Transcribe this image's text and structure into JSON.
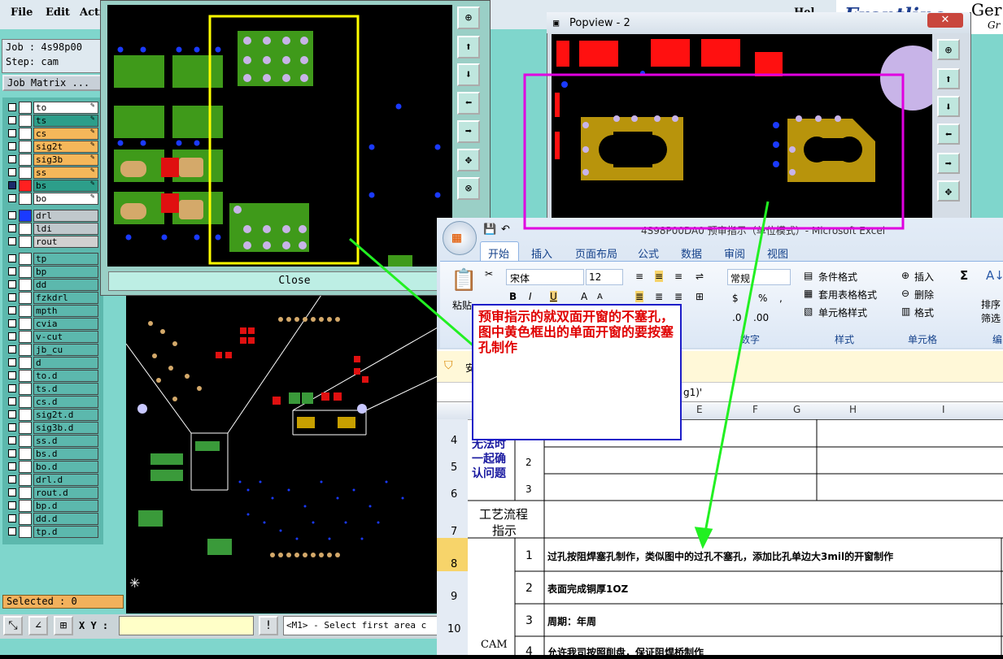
{
  "menu": {
    "file": "File",
    "edit": "Edit",
    "action": "Acti",
    "help": "Hel"
  },
  "logo": {
    "brand": "Frontline",
    "brand2": "Ger",
    "brand3": "Gr"
  },
  "job": {
    "line1": "Job : 4s98p00",
    "line2": "Step: cam",
    "matrix_button": "Job Matrix ..."
  },
  "layers": [
    {
      "name": "to",
      "color": "#ffffff"
    },
    {
      "name": "ts",
      "color": "#2d9e8a"
    },
    {
      "name": "cs",
      "color": "#f5b75a"
    },
    {
      "name": "sig2t",
      "color": "#f5b75a"
    },
    {
      "name": "sig3b",
      "color": "#f5b75a"
    },
    {
      "name": "ss",
      "color": "#f5b75a"
    },
    {
      "name": "bs",
      "color": "#2d9e8a"
    },
    {
      "name": "bo",
      "color": "#ffffff"
    },
    {
      "name": "drl",
      "color": "#c0c8cc"
    },
    {
      "name": "ldi",
      "color": "#c0c8cc"
    },
    {
      "name": "rout",
      "color": "#d0d0d0"
    },
    {
      "name": "tp",
      "color": "#5cb8ad"
    },
    {
      "name": "bp",
      "color": "#5cb8ad"
    },
    {
      "name": "dd",
      "color": "#5cb8ad"
    },
    {
      "name": "fzkdrl",
      "color": "#5cb8ad"
    },
    {
      "name": "mpth",
      "color": "#5cb8ad"
    },
    {
      "name": "cvia",
      "color": "#5cb8ad"
    },
    {
      "name": "v-cut",
      "color": "#5cb8ad"
    },
    {
      "name": "jb_cu",
      "color": "#5cb8ad"
    },
    {
      "name": "d",
      "color": "#5cb8ad"
    },
    {
      "name": "to.d",
      "color": "#5cb8ad"
    },
    {
      "name": "ts.d",
      "color": "#5cb8ad"
    },
    {
      "name": "cs.d",
      "color": "#5cb8ad"
    },
    {
      "name": "sig2t.d",
      "color": "#5cb8ad"
    },
    {
      "name": "sig3b.d",
      "color": "#5cb8ad"
    },
    {
      "name": "ss.d",
      "color": "#5cb8ad"
    },
    {
      "name": "bs.d",
      "color": "#5cb8ad"
    },
    {
      "name": "bo.d",
      "color": "#5cb8ad"
    },
    {
      "name": "drl.d",
      "color": "#5cb8ad"
    },
    {
      "name": "rout.d",
      "color": "#5cb8ad"
    },
    {
      "name": "bp.d",
      "color": "#5cb8ad"
    },
    {
      "name": "dd.d",
      "color": "#5cb8ad"
    },
    {
      "name": "tp.d",
      "color": "#5cb8ad"
    }
  ],
  "status": {
    "selected": "Selected : 0",
    "xy_label": "X Y :",
    "prompt": "<M1> - Select first area c"
  },
  "popview1": {
    "close": "Close"
  },
  "popview2": {
    "title": "Popview - 2",
    "close": "✕"
  },
  "excel": {
    "tabs": [
      "开始",
      "插入",
      "页面布局",
      "公式",
      "数据",
      "审阅",
      "视图"
    ],
    "font": "宋体",
    "size": "12",
    "numfmt": "常规",
    "paste": "粘贴",
    "styles": [
      "条件格式",
      "套用表格格式",
      "单元格样式"
    ],
    "cells_group": [
      "插入",
      "删除",
      "格式"
    ],
    "groups": [
      "数字",
      "样式",
      "单元格",
      "编"
    ],
    "sort": "排序",
    "filter": "筛选",
    "security": "安",
    "formula_tail": "g1)'",
    "title_frag": "4S98P00DA0 预审指示（单位模式）- Microsoft Excel",
    "cols": [
      "E",
      "F",
      "G",
      "H",
      "I"
    ],
    "rows": [
      {
        "num": "4",
        "a": "无法时",
        "b": "",
        "c": ""
      },
      {
        "num": "5",
        "a": "一起确",
        "b": "2",
        "c": ""
      },
      {
        "num": "6",
        "a": "认问题",
        "b": "3",
        "c": ""
      },
      {
        "num": "7",
        "a": "工艺流程指示",
        "b": "",
        "c": ""
      },
      {
        "num": "8",
        "a": "",
        "b": "1",
        "c": "过孔按阻焊塞孔制作，类似图中的过孔不塞孔，添加比孔单边大3mil的开窗制作"
      },
      {
        "num": "9",
        "a": "",
        "b": "2",
        "c": "表面完成铜厚1OZ"
      },
      {
        "num": "10",
        "a": "CAM",
        "b": "3",
        "c": "周期：年周"
      },
      {
        "num": "",
        "a": "",
        "b": "4",
        "c": "允许我司按照削盘，保证阻焊桥制作"
      }
    ],
    "row7_a1": "工艺流程",
    "row7_a2": "指示",
    "row_cam2": "指示"
  },
  "note": {
    "text": "预审指示的就双面开窗的不塞孔，图中黄色框出的单面开窗的要按塞孔制作"
  }
}
